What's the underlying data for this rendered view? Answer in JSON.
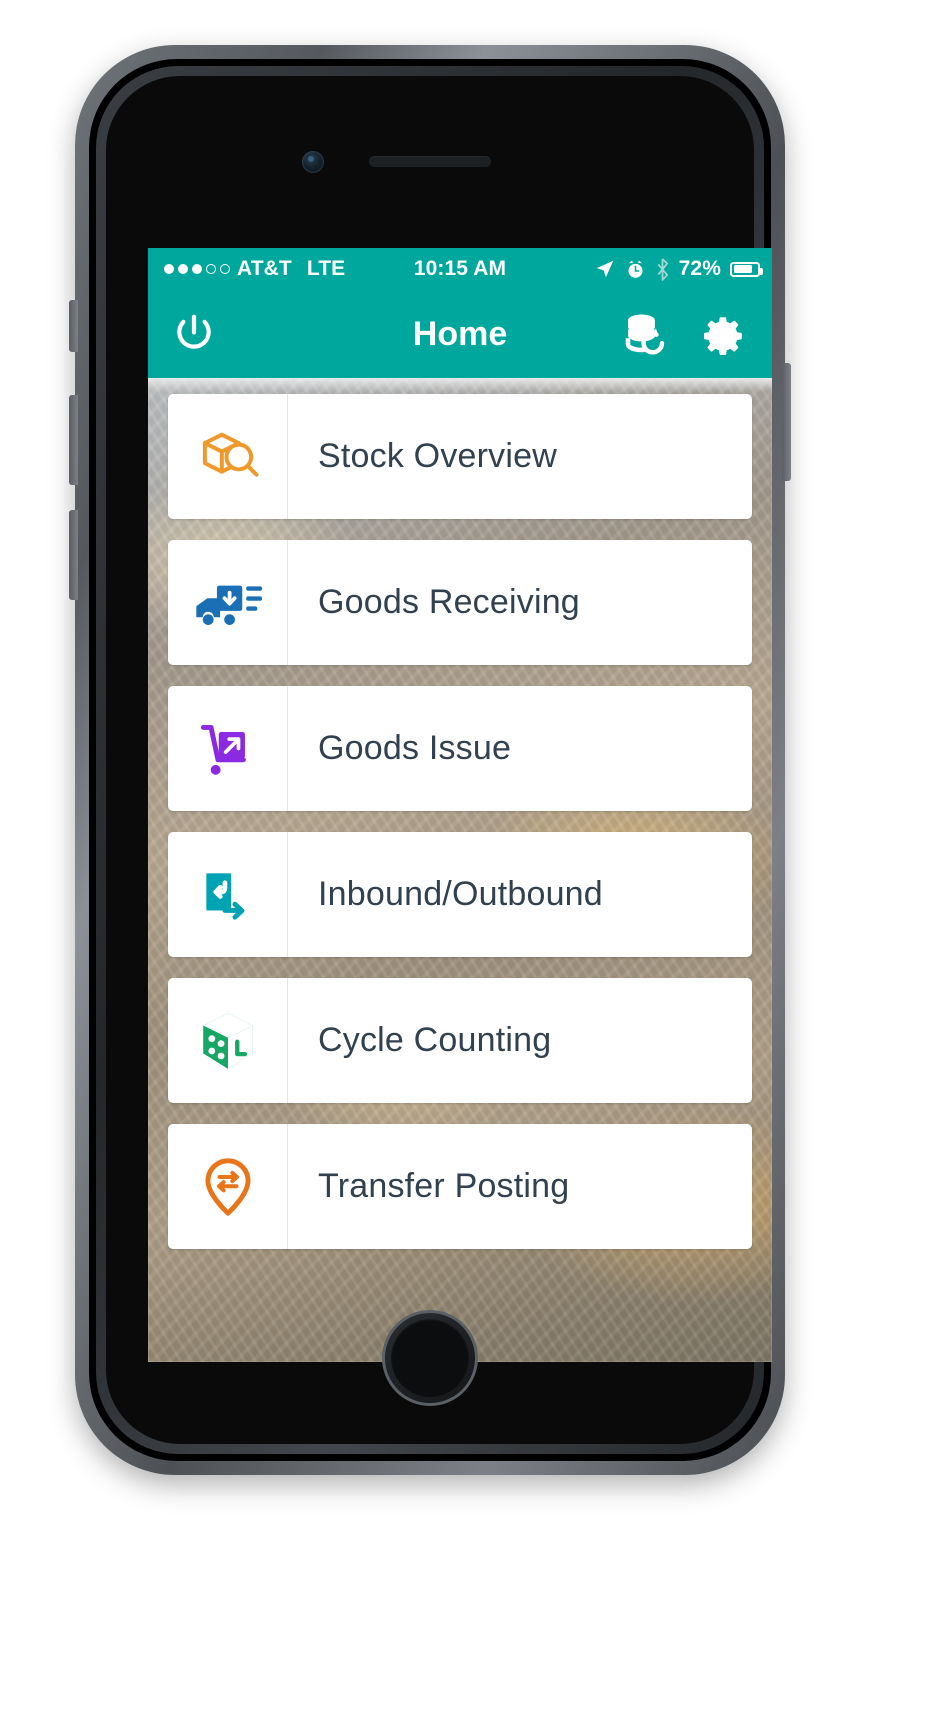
{
  "status_bar": {
    "signal_dots": [
      true,
      true,
      true,
      false,
      false
    ],
    "carrier": "AT&T",
    "network": "LTE",
    "time": "10:15 AM",
    "icons": [
      "location-arrow-icon",
      "alarm-clock-icon",
      "bluetooth-icon"
    ],
    "battery_percent": "72%",
    "battery_level": 72
  },
  "nav_bar": {
    "title": "Home",
    "left_action": "power-icon",
    "right_actions": [
      "database-sync-icon",
      "gear-icon"
    ]
  },
  "menu": {
    "items": [
      {
        "label": "Stock Overview",
        "icon": "box-search-icon",
        "color": "#F0992B"
      },
      {
        "label": "Goods Receiving",
        "icon": "delivery-truck-in-icon",
        "color": "#1B6FB5"
      },
      {
        "label": "Goods Issue",
        "icon": "hand-truck-out-icon",
        "color": "#8A2BE2"
      },
      {
        "label": "Inbound/Outbound",
        "icon": "door-arrow-icon",
        "color": "#00A3B4"
      },
      {
        "label": "Cycle Counting",
        "icon": "dice-cube-icon",
        "color": "#16A765"
      },
      {
        "label": "Transfer Posting",
        "icon": "location-transfer-icon",
        "color": "#E8751A"
      }
    ]
  },
  "theme": {
    "accent": "#00A79D",
    "card_background": "#FFFFFF",
    "label_color": "#32414F"
  }
}
